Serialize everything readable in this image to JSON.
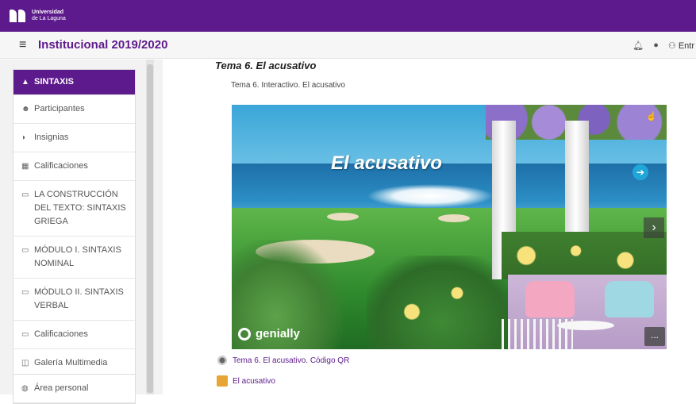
{
  "brand": {
    "line1": "Universidad",
    "line2": "de La Laguna"
  },
  "navbar": {
    "site_title": "Institucional 2019/2020",
    "right_label": "Entr"
  },
  "sidebar": {
    "items": [
      {
        "label": "SINTAXIS",
        "icon": "graduation-cap-icon"
      },
      {
        "label": "Participantes",
        "icon": "users-icon"
      },
      {
        "label": "Insignias",
        "icon": "shield-icon"
      },
      {
        "label": "Calificaciones",
        "icon": "table-icon"
      },
      {
        "label": "LA CONSTRUCCIÓN DEL TEXTO: SINTAXIS GRIEGA",
        "icon": "folder-icon"
      },
      {
        "label": "MÓDULO I. SINTAXIS NOMINAL",
        "icon": "folder-icon"
      },
      {
        "label": "MÓDULO II. SINTAXIS VERBAL",
        "icon": "folder-icon"
      },
      {
        "label": "Calificaciones",
        "icon": "folder-icon"
      },
      {
        "label": "Galería Multimedia",
        "icon": "gallery-icon"
      }
    ],
    "bottom_items": [
      {
        "label": "Área personal",
        "icon": "dashboard-icon"
      }
    ]
  },
  "main": {
    "section_title": "Tema 6. El acusativo",
    "subtitle": "Tema 6. Interactivo. El acusativo",
    "embed": {
      "title": "El acusativo",
      "brand": "genially",
      "more_label": "..."
    },
    "resources": [
      {
        "label": "Tema 6. El acusativo. Código QR",
        "icon": "qr-resource-icon"
      },
      {
        "label": "El acusativo",
        "icon": "book-resource-icon"
      }
    ]
  },
  "colors": {
    "brand_purple": "#5d1a8c",
    "accent_blue": "#20a7d8"
  }
}
